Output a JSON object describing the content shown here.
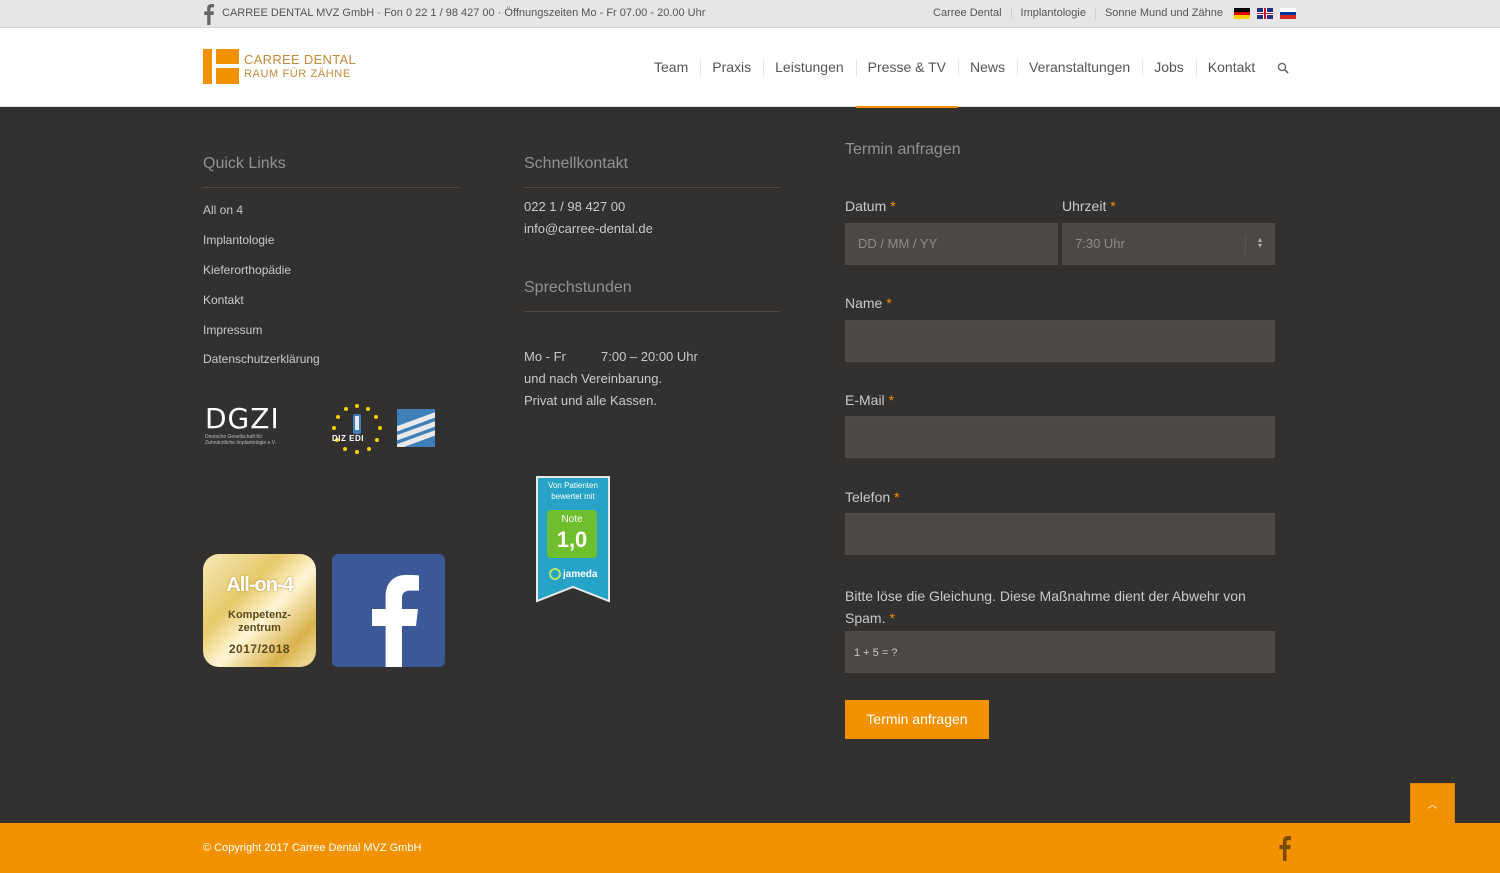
{
  "topbar": {
    "info": "CARREE DENTAL MVZ GmbH · Fon 0 22 1 / 98 427 00 · Öffnungszeiten Mo - Fr 07.00 - 20.00 Uhr",
    "links": [
      "Carree Dental",
      "Implantologie",
      "Sonne Mund und Zähne"
    ],
    "languages": [
      "de-flag",
      "en-flag",
      "ru-flag"
    ]
  },
  "header": {
    "logo_line1": "CARREE DENTAL",
    "logo_line2": "RAUM FÜR ZÄHNE",
    "nav": [
      "Team",
      "Praxis",
      "Leistungen",
      "Presse & TV",
      "News",
      "Veranstaltungen",
      "Jobs",
      "Kontakt"
    ],
    "active_nav": "Presse & TV"
  },
  "quick_links": {
    "title": "Quick Links",
    "items": [
      "All on 4",
      "Implantologie",
      "Kieferorthopädie",
      "Kontakt",
      "Impressum",
      "Datenschutzerklärung"
    ],
    "partner_logos": {
      "dgzi": "DGZI",
      "dgzi_sub": "Deutsche Gesellschaft für Zahnärztliche Implantologie e.V.",
      "diz": "DIZ EDI"
    },
    "allon4_badge": {
      "title": "All-on-4",
      "line1": "Kompetenz-",
      "line2": "zentrum",
      "year": "2017/2018"
    }
  },
  "contact": {
    "title": "Schnellkontakt",
    "phone": "022 1 / 98 427 00",
    "email": "info@carree-dental.de",
    "hours_title": "Sprechstunden",
    "hours_days": "Mo - Fr",
    "hours_time": "7:00 – 20:00 Uhr",
    "hours_line2": "und nach Vereinbarung.",
    "hours_line3": "Privat und alle Kassen.",
    "jameda": {
      "line1": "Von Patienten",
      "line2": "bewertet mit",
      "note_label": "Note",
      "note_value": "1,0",
      "brand": "jameda"
    }
  },
  "form": {
    "title": "Termin anfragen",
    "date_label": "Datum",
    "date_placeholder": "DD / MM / YY",
    "time_label": "Uhrzeit",
    "time_value": "7:30 Uhr",
    "name_label": "Name",
    "email_label": "E-Mail",
    "phone_label": "Telefon",
    "captcha_label": "Bitte löse die Gleichung. Diese Maßnahme dient der Abwehr von Spam.",
    "captcha_question": "1 + 5 = ?",
    "required_mark": "*",
    "submit": "Termin anfragen"
  },
  "footer": {
    "copyright": "© Copyright 2017 Carree Dental MVZ GmbH"
  },
  "colors": {
    "accent": "#f39200",
    "footer_bg": "#333130",
    "field_bg": "#4b4846"
  }
}
